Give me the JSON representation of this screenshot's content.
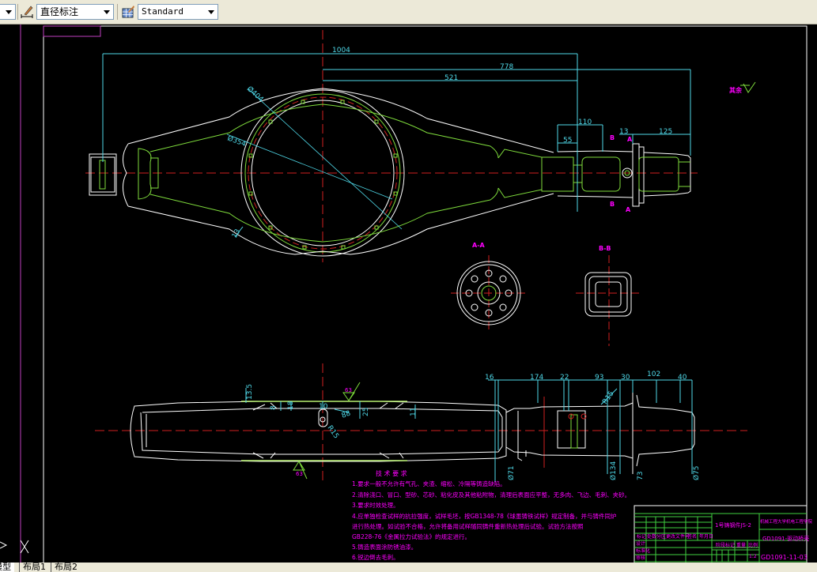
{
  "toolbar": {
    "dim_style_value": "直径标注",
    "table_style_value": "Standard",
    "icons": [
      "dimension-style-icon",
      "table-style-icon"
    ]
  },
  "drawing": {
    "dims_top": {
      "d1004": "1004",
      "d778": "778",
      "d521": "521",
      "d110": "110",
      "d55": "55",
      "d13": "13",
      "d125": "125",
      "phi404": "Ø404",
      "phi354": "Ø354",
      "r13": "13"
    },
    "roughness_note": "其余",
    "section_aa": "A-A",
    "section_bb": "B-B",
    "mark_a": "A",
    "mark_b": "B",
    "dims_bottom": {
      "d16": "16",
      "d174": "174",
      "d22": "22",
      "d93": "93",
      "d30": "30",
      "d102": "102",
      "d40": "40",
      "d13_5": "13.5",
      "d8": "8",
      "d18": "18",
      "d10": "10",
      "d88": "88",
      "d25": "25",
      "d11": "11",
      "r15": "R15",
      "r15b": "R15",
      "phi71": "Ø71",
      "phi134": "Ø134",
      "d73": "73",
      "phi75": "Ø75",
      "ra63_top": "63",
      "ra63_bottom": "63"
    },
    "tech_requirements": {
      "title": "技 术 要 求",
      "lines": [
        "1.要求一般不允许有气孔、夹渣、缩松、冷隔等铸造缺陷。",
        "2.清除浇口、冒口、型砂、芯砂、粘化皮及其他粘附物，清理后表面应平整，无多肉、飞边、毛刺、夹砂。",
        "3.要求时效处理。",
        "4.应单独检查试样的抗拉强度，试样毛坯，按GB1348-78《球墨铸铁试样》规定制备，并与铸件同炉",
        "进行热处理。如试验不合格，允许将备用试样随同铸件重新热处理后试验。试验方法按照",
        "GB228-76《金属拉力试验法》的规定进行。",
        "5.铸造表面涂防锈油漆。",
        "6.锐边倒去毛刺。"
      ]
    },
    "title_block": {
      "material": "1号铸钢件JS-2",
      "school": "机械工程大学机电工程学院",
      "drawing_name": "GD1091-驱动桥壳",
      "drawing_number": "GD1091-11-03",
      "scale": "1:2",
      "header_cells": [
        "标记",
        "处数",
        "分区",
        "更改文件号",
        "签名",
        "年月日"
      ],
      "row_labels": [
        "设计",
        "标准化",
        "审核",
        "工艺",
        "批准"
      ],
      "stage_labels": [
        "阶段标记",
        "重量",
        "比例"
      ]
    },
    "colors": {
      "outline": "#ffffff",
      "green": "#7fdc3c",
      "cyan": "#4fd8e8",
      "center": "#d02020",
      "magenta": "#ff00ff"
    }
  },
  "tabs": [
    {
      "label": "模型",
      "active": true
    },
    {
      "label": "布局1",
      "active": false
    },
    {
      "label": "布局2",
      "active": false
    }
  ]
}
